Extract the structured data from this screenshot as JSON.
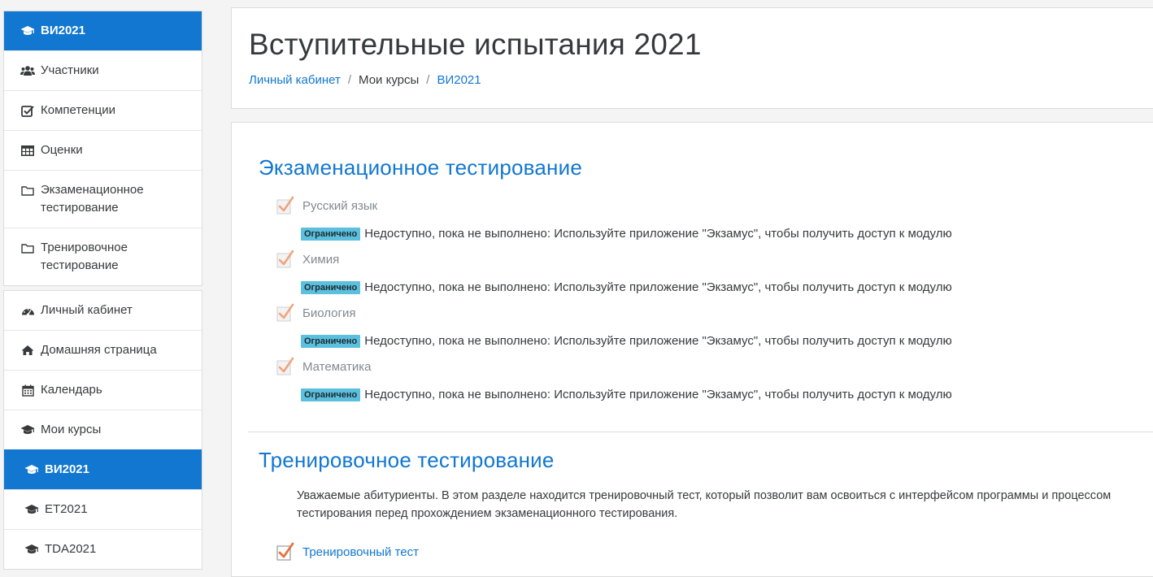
{
  "sidebar": {
    "course_block": {
      "header": "ВИ2021",
      "items": [
        {
          "label": "Участники",
          "icon": "users-icon"
        },
        {
          "label": "Компетенции",
          "icon": "check-square-icon"
        },
        {
          "label": "Оценки",
          "icon": "table-icon"
        },
        {
          "label": "Экзаменационное тестирование",
          "icon": "folder-icon"
        },
        {
          "label": "Тренировочное тестирование",
          "icon": "folder-icon"
        }
      ]
    },
    "site_block": {
      "items": [
        {
          "label": "Личный кабинет",
          "icon": "dashboard-icon"
        },
        {
          "label": "Домашняя страница",
          "icon": "home-icon"
        },
        {
          "label": "Календарь",
          "icon": "calendar-icon"
        },
        {
          "label": "Мои курсы",
          "icon": "graduation-cap-icon"
        },
        {
          "label": "ВИ2021",
          "icon": "graduation-cap-icon",
          "active": true
        },
        {
          "label": "ET2021",
          "icon": "graduation-cap-icon"
        },
        {
          "label": "TDA2021",
          "icon": "graduation-cap-icon"
        }
      ]
    }
  },
  "header": {
    "title": "Вступительные испытания 2021",
    "breadcrumb": [
      "Личный кабинет",
      "Мои курсы",
      "ВИ2021"
    ]
  },
  "sections": [
    {
      "title": "Экзаменационное тестирование",
      "activities": [
        {
          "name": "Русский язык",
          "badge": "Ограничено",
          "restriction": "Недоступно, пока не выполнено: Используйте приложение \"Экзамус\", чтобы получить доступ к модулю"
        },
        {
          "name": "Химия",
          "badge": "Ограничено",
          "restriction": "Недоступно, пока не выполнено: Используйте приложение \"Экзамус\", чтобы получить доступ к модулю"
        },
        {
          "name": "Биология",
          "badge": "Ограничено",
          "restriction": "Недоступно, пока не выполнено: Используйте приложение \"Экзамус\", чтобы получить доступ к модулю"
        },
        {
          "name": "Математика",
          "badge": "Ограничено",
          "restriction": "Недоступно, пока не выполнено: Используйте приложение \"Экзамус\", чтобы получить доступ к модулю"
        }
      ]
    },
    {
      "title": "Тренировочное тестирование",
      "summary": "Уважаемые абитуриенты. В этом разделе находится тренировочный тест, который позволит вам освоиться с интерфейсом программы и процессом тестирования перед прохождением экзаменационного тестирования.",
      "activities": [
        {
          "name": "Тренировочный тест"
        }
      ]
    }
  ],
  "colors": {
    "accent": "#1177d1",
    "badge": "#5bc0de",
    "quiz_icon_check": "#e5723a"
  }
}
